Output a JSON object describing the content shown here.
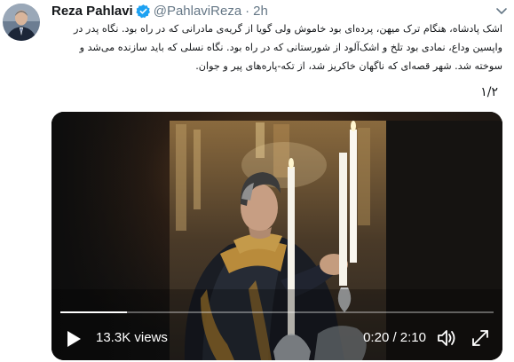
{
  "author": {
    "name": "Reza Pahlavi",
    "handle": "@PahlaviReza",
    "separator": "·",
    "time": "2h",
    "verified": true,
    "avatar_icon": "profile-photo"
  },
  "tweet": {
    "text": "اشک پادشاه، هنگام ترک میهن، پرده‌ای بود خاموش ولی گویا از گریه‌ی مادرانی که در راه بود. نگاه پدر در واپسین وداع، نمادی بود تلخ و اشک‌آلود از شورستانی که در راه بود. نگاه نسلی که باید سازنده می‌شد و سوخته شد. شهر قصه‌ای که ناگهان خاکریز شد، از تکه-پاره‌های پیر و جوان.",
    "thread_counter": "۱/۲"
  },
  "video": {
    "views": "13.3K views",
    "timecode": "0:20 / 2:10",
    "progress": 0.154,
    "icons": {
      "play": "play-icon",
      "volume": "volume-icon",
      "fullscreen": "fullscreen-icon"
    }
  },
  "colors": {
    "accent": "#1da1f2",
    "secondary_text": "#657786",
    "primary_text": "#14171a"
  }
}
